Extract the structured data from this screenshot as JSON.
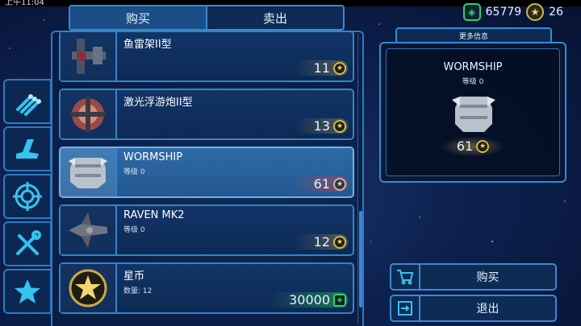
{
  "status": {
    "time": "上午11:04"
  },
  "tabs": [
    {
      "label": "购买",
      "active": true
    },
    {
      "label": "卖出",
      "active": false
    }
  ],
  "currency": {
    "credits": "65779",
    "stars": "26"
  },
  "categories": [
    {
      "icon": "torpedo-icon"
    },
    {
      "icon": "ship-icon"
    },
    {
      "icon": "target-icon"
    },
    {
      "icon": "tools-icon"
    },
    {
      "icon": "star-icon"
    }
  ],
  "items": [
    {
      "name": "鱼雷架II型",
      "level": "",
      "price": "11",
      "currency": "star"
    },
    {
      "name": "激光浮游炮II型",
      "level": "",
      "price": "13",
      "currency": "star"
    },
    {
      "name": "WORMSHIP",
      "level": "等级 0",
      "price": "61",
      "currency": "star",
      "selected": true
    },
    {
      "name": "RAVEN MK2",
      "level": "等级 0",
      "price": "12",
      "currency": "star"
    },
    {
      "name": "星币",
      "level": "数量: 12",
      "price": "30000",
      "currency": "credits"
    }
  ],
  "detail": {
    "header": "更多信息",
    "name": "WORMSHIP",
    "level": "等级 0",
    "price": "61"
  },
  "actions": {
    "buy": "购买",
    "exit": "退出"
  },
  "colors": {
    "accent": "#3a8ad0",
    "gold": "#d6b54c",
    "green": "#2ad46b"
  }
}
